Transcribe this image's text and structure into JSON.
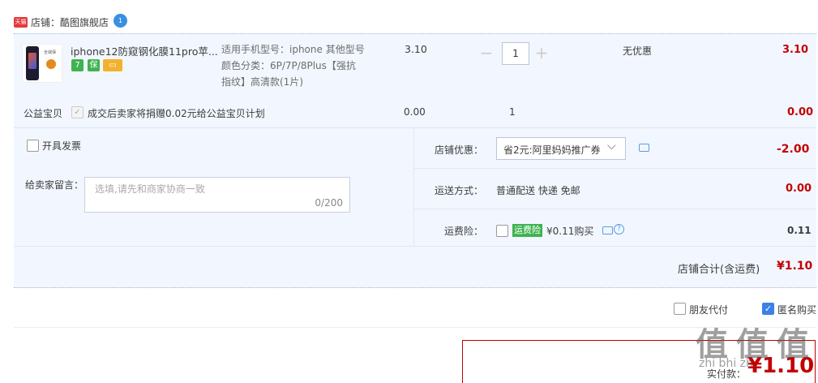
{
  "shop": {
    "badge": "天猫",
    "label": "店铺：酷图旗舰店",
    "ww_badge": "1"
  },
  "product": {
    "title": "iphone12防窥钢化膜11pro苹...",
    "image_brand_text": "全城保",
    "service_icons": [
      {
        "name": "seven-day-return-icon",
        "glyph": "7",
        "color": "#3eb34f"
      },
      {
        "name": "guarantee-icon",
        "glyph": "保",
        "color": "#3eb34f"
      },
      {
        "name": "credit-card-icon",
        "glyph": "▭",
        "color": "#f3b12e"
      }
    ],
    "attr_lines": [
      "适用手机型号：iphone 其他型号",
      "颜色分类：6P/7P/8Plus【强抗",
      "指纹】高清款(1片)"
    ],
    "price": "3.10",
    "qty": "1",
    "qty_minus": "−",
    "qty_plus": "+",
    "promo": "无优惠",
    "subtotal": "3.10"
  },
  "charity": {
    "label": "公益宝贝",
    "desc": "成交后卖家将捐赠0.02元给公益宝贝计划",
    "price": "0.00",
    "qty": "1",
    "total": "0.00"
  },
  "invoice": {
    "label": "开具发票"
  },
  "note": {
    "label": "给卖家留言：",
    "placeholder": "选填,请先和商家协商一致",
    "counter": "0/200"
  },
  "shop_discount": {
    "label": "店铺优惠：",
    "value": "省2元:阿里妈妈推广券",
    "amount": "-2.00"
  },
  "shipping": {
    "label": "运送方式：",
    "value": "普通配送 快递 免邮",
    "amount": "0.00"
  },
  "insurance": {
    "label": "运费险：",
    "tag": "运费险",
    "desc": "¥0.11购买",
    "amount": "0.11"
  },
  "shop_total": {
    "label": "店铺合计(含运费)",
    "amount": "¥1.10"
  },
  "options": {
    "friend_pay": "朋友代付",
    "anonymous": "匿名购买"
  },
  "payment": {
    "label": "实付款：",
    "amount": "¥1.10"
  },
  "watermark": {
    "text": "值 值 值",
    "site": "zhi bhi zh."
  },
  "colors": {
    "accent_red": "#c40000",
    "block_bg": "#f2f7ff",
    "checkbox_blue": "#3c80e8",
    "tag_green": "#3eb34f"
  }
}
